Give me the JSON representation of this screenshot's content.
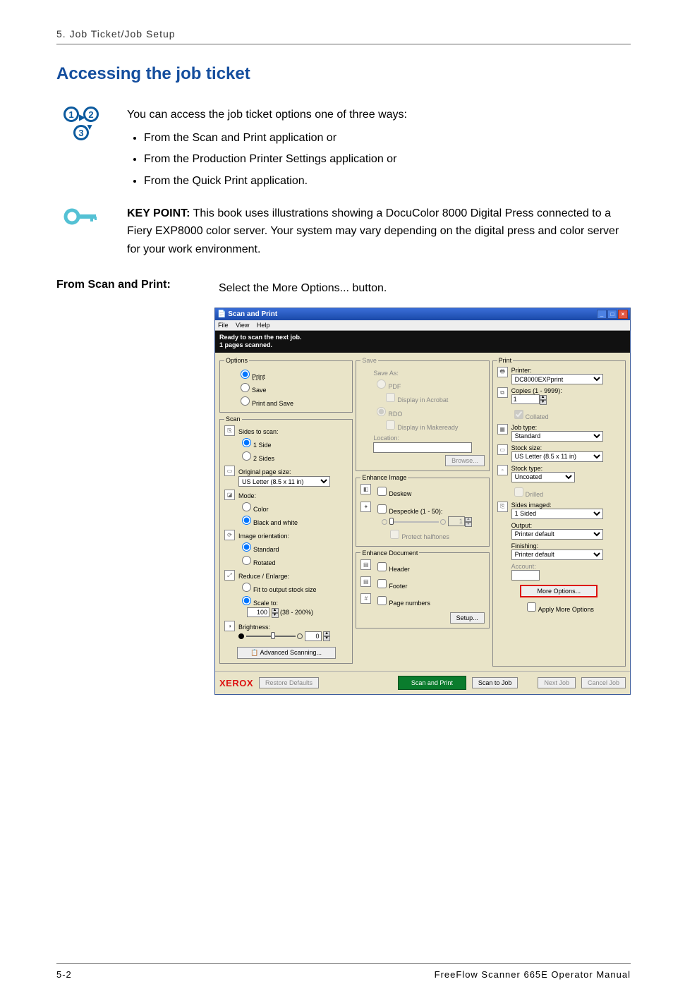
{
  "header": "5. Job Ticket/Job Setup",
  "title": "Accessing the job ticket",
  "intro": "You can access the job ticket options one of three ways:",
  "bullets": [
    "From the Scan and Print application or",
    "From the Production Printer Settings application or",
    "From the Quick Print application."
  ],
  "keypoint_label": "KEY POINT:",
  "keypoint_text": " This book uses illustrations showing a DocuColor 8000 Digital Press connected to a Fiery EXP8000 color server.  Your system may vary depending on the digital press and color server for your work environment.",
  "from_label": "From Scan and Print:",
  "from_text": "Select the More Options... button.",
  "window": {
    "title": "Scan and Print",
    "menu": {
      "file": "File",
      "view": "View",
      "help": "Help"
    },
    "status1": "Ready to scan the next job.",
    "status2": "1 pages scanned.",
    "options": {
      "legend": "Options",
      "print": "Print",
      "save": "Save",
      "print_save": "Print and Save"
    },
    "scan": {
      "legend": "Scan",
      "sides_label": "Sides to scan:",
      "side1": "1 Side",
      "side2": "2 Sides",
      "pagesize_label": "Original page size:",
      "pagesize_value": "US Letter (8.5 x 11 in)",
      "mode_label": "Mode:",
      "mode_color": "Color",
      "mode_bw": "Black and white",
      "orient_label": "Image orientation:",
      "orient_std": "Standard",
      "orient_rot": "Rotated",
      "reduce_label": "Reduce / Enlarge:",
      "reduce_fit": "Fit to output stock size",
      "reduce_scale": "Scale to:",
      "scale_value": "100",
      "scale_range": "(38 - 200%)",
      "bright_label": "Brightness:",
      "bright_value": "0",
      "adv_btn": "Advanced Scanning..."
    },
    "save": {
      "legend": "Save",
      "saveas": "Save As:",
      "pdf": "PDF",
      "acrobat": "Display in Acrobat",
      "rdo": "RDO",
      "makeready": "Display in Makeready",
      "location": "Location:",
      "browse": "Browse..."
    },
    "enhance_img": {
      "legend": "Enhance Image",
      "deskew": "Deskew",
      "despeckle": "Despeckle (1 - 50):",
      "despeckle_val": "1",
      "protect": "Protect halftones"
    },
    "enhance_doc": {
      "legend": "Enhance Document",
      "header": "Header",
      "footer": "Footer",
      "pagenum": "Page numbers",
      "setup": "Setup..."
    },
    "print": {
      "legend": "Print",
      "printer_label": "Printer:",
      "printer_value": "DC8000EXPprint",
      "copies_label": "Copies (1 - 9999):",
      "copies_value": "1",
      "collated": "Collated",
      "jobtype_label": "Job type:",
      "jobtype_value": "Standard",
      "stocksize_label": "Stock size:",
      "stocksize_value": "US Letter (8.5 x 11 in)",
      "stocktype_label": "Stock type:",
      "stocktype_value": "Uncoated",
      "drilled": "Drilled",
      "sides_label": "Sides imaged:",
      "sides_value": "1 Sided",
      "output_label": "Output:",
      "output_value": "Printer default",
      "finish_label": "Finishing:",
      "finish_value": "Printer default",
      "account_label": "Account:",
      "more_btn": "More Options...",
      "apply_btn": "Apply More Options"
    },
    "bottom": {
      "xerox": "XEROX",
      "restore": "Restore Defaults",
      "scanprint": "Scan and Print",
      "scanjob": "Scan to Job",
      "nextjob": "Next Job",
      "cancel": "Cancel Job"
    }
  },
  "footer": {
    "pageno": "5-2",
    "manual": "FreeFlow Scanner 665E Operator Manual"
  }
}
